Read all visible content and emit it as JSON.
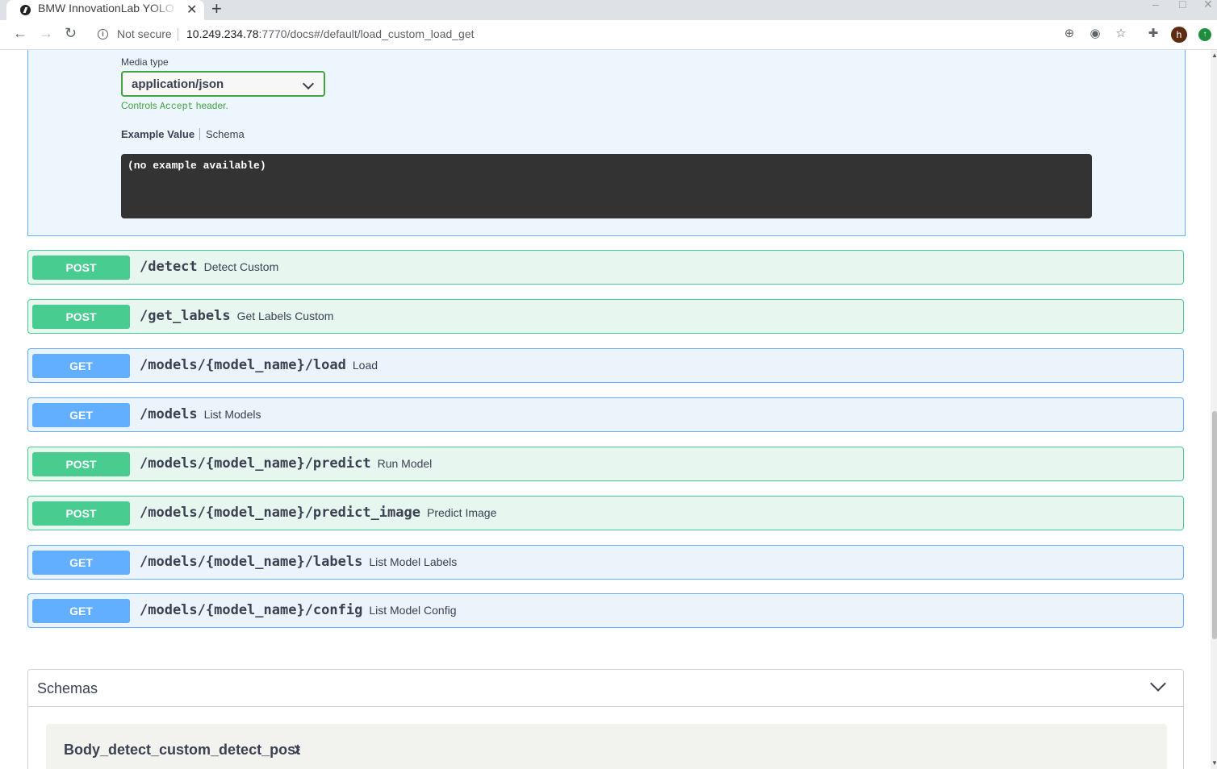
{
  "browser": {
    "tab_title": "BMW InnovationLab YOLO",
    "new_tab": "+",
    "not_secure": "Not secure",
    "url_host": "10.249.234.78",
    "url_rest": ":7770/docs#/default/load_custom_load_get",
    "avatar_letter": "h"
  },
  "response": {
    "media_type_label": "Media type",
    "media_type_value": "application/json",
    "controls_prefix": "Controls ",
    "controls_code": "Accept",
    "controls_suffix": " header.",
    "tab_example": "Example Value",
    "tab_schema": "Schema",
    "example_text": "(no example available)"
  },
  "operations": [
    {
      "method": "POST",
      "path": "/detect",
      "summary": "Detect Custom"
    },
    {
      "method": "POST",
      "path": "/get_labels",
      "summary": "Get Labels Custom"
    },
    {
      "method": "GET",
      "path": "/models/{model_name}/load",
      "summary": "Load"
    },
    {
      "method": "GET",
      "path": "/models",
      "summary": "List Models"
    },
    {
      "method": "POST",
      "path": "/models/{model_name}/predict",
      "summary": "Run Model"
    },
    {
      "method": "POST",
      "path": "/models/{model_name}/predict_image",
      "summary": "Predict Image"
    },
    {
      "method": "GET",
      "path": "/models/{model_name}/labels",
      "summary": "List Model Labels"
    },
    {
      "method": "GET",
      "path": "/models/{model_name}/config",
      "summary": "List Model Config"
    }
  ],
  "schemas": {
    "title": "Schemas",
    "items": [
      "Body_detect_custom_detect_post"
    ]
  },
  "colors": {
    "post": "#49cc90",
    "get": "#61affe",
    "text": "#3b4151"
  }
}
